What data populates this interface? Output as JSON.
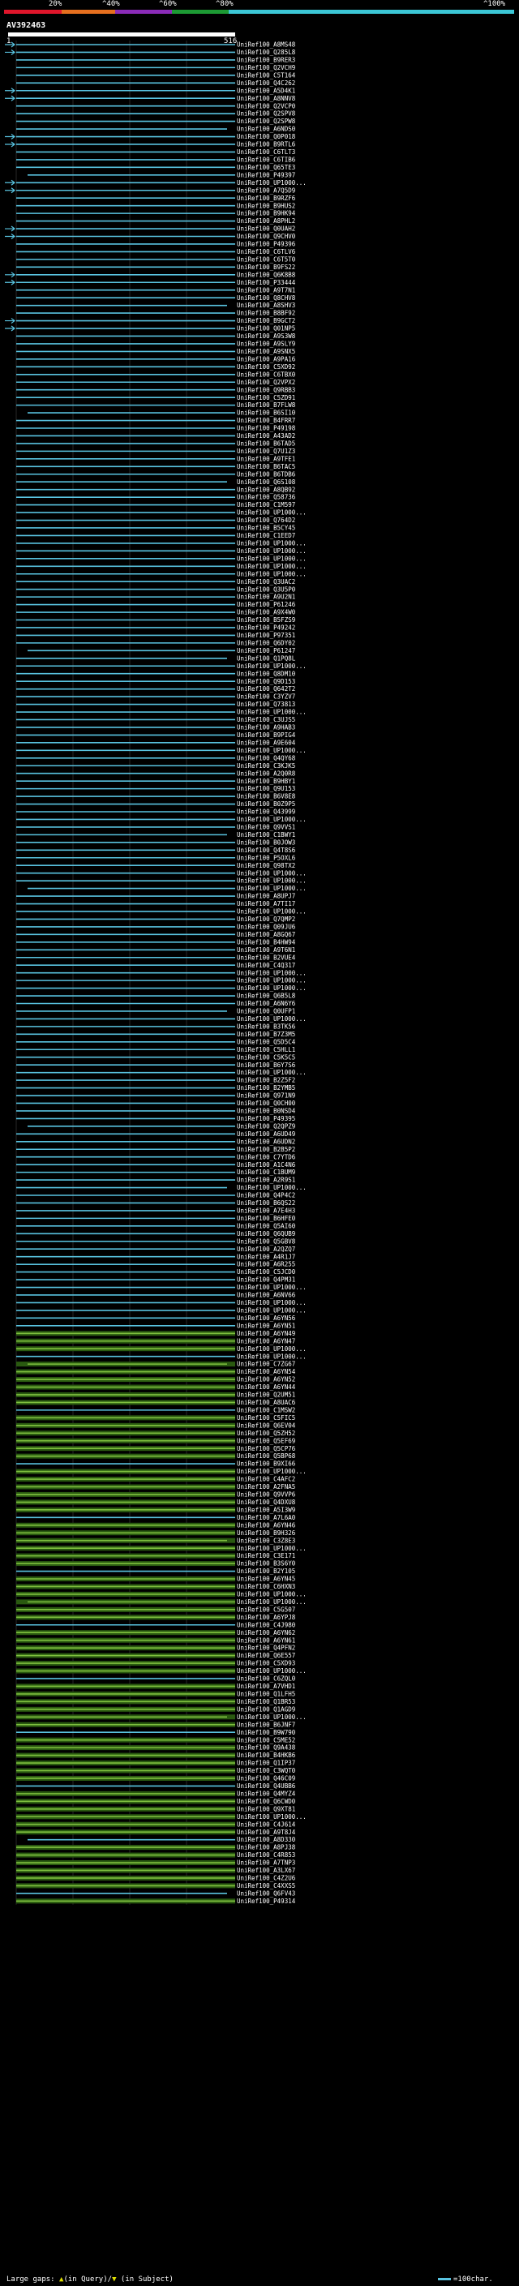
{
  "scale": {
    "ticks": [
      "20%",
      "^40%",
      "^60%",
      "^80%",
      "^100%"
    ],
    "colors": [
      "#e0162b",
      "#e56f1f",
      "#8a2bb8",
      "#1d9a34",
      "#3cc7d6"
    ]
  },
  "query": {
    "id": "AV392463",
    "start": "1",
    "end": "516"
  },
  "colors": {
    "cyan": "#59c3e0",
    "green": "#7fbf3f",
    "dark_green": "#2a5a10",
    "grid": "#444444"
  },
  "hits": [
    "UniRef100_A8MS48",
    "UniRef100_Q285L8",
    "UniRef100_B9RER3",
    "UniRef100_Q2VCH9",
    "UniRef100_C5T164",
    "UniRef100_Q4C262",
    "UniRef100_A5D4K1",
    "UniRef100_A8NNV8",
    "UniRef100_Q2VCP0",
    "UniRef100_Q2SPV8",
    "UniRef100_Q2SPW8",
    "UniRef100_A6NDS0",
    "UniRef100_Q0P018",
    "UniRef100_B9RTL6",
    "UniRef100_C6TLT3",
    "UniRef100_C6TIB6",
    "UniRef100_Q65TE3",
    "UniRef100_P49397",
    "UniRef100_UP1000...",
    "UniRef100_A7Q5D9",
    "UniRef100_B9RZF6",
    "UniRef100_B9HUS2",
    "UniRef100_B9HK94",
    "UniRef100_A8PHL2",
    "UniRef100_Q0UAH2",
    "UniRef100_Q9CHV0",
    "UniRef100_P49396",
    "UniRef100_C6TLV6",
    "UniRef100_C6T5T0",
    "UniRef100_B9FS22",
    "UniRef100_Q6K8B8",
    "UniRef100_P33444",
    "UniRef100_A9T7N1",
    "UniRef100_Q8CHV8",
    "UniRef100_A8SHV3",
    "UniRef100_B8BF92",
    "UniRef100_B9GCT2",
    "UniRef100_Q01NP5",
    "UniRef100_A9S3W8",
    "UniRef100_A9SLY9",
    "UniRef100_A9SNX5",
    "UniRef100_A9PA16",
    "UniRef100_C5XD92",
    "UniRef100_C6TBX0",
    "UniRef100_Q2VPX2",
    "UniRef100_Q9RBB3",
    "UniRef100_C5ZD91",
    "UniRef100_B7FLW8",
    "UniRef100_B6SI10",
    "UniRef100_B4FRR7",
    "UniRef100_P49198",
    "UniRef100_A43AD2",
    "UniRef100_B6TAD5",
    "UniRef100_Q7U1Z3",
    "UniRef100_A9TFE1",
    "UniRef100_B6TAC5",
    "UniRef100_B6TDB6",
    "UniRef100_Q6S108",
    "UniRef100_A8QB92",
    "UniRef100_Q58736",
    "UniRef100_C1M597",
    "UniRef100_UP1000...",
    "UniRef100_Q764D2",
    "UniRef100_B5CY45",
    "UniRef100_C1EED7",
    "UniRef100_UP1000...",
    "UniRef100_UP1000...",
    "UniRef100_UP1000...",
    "UniRef100_UP1000...",
    "UniRef100_UP1000...",
    "UniRef100_Q3UAC2",
    "UniRef100_Q3U5P0",
    "UniRef100_A9U2N1",
    "UniRef100_P61246",
    "UniRef100_A9X4W0",
    "UniRef100_B5FZS9",
    "UniRef100_P49242",
    "UniRef100_P97351",
    "UniRef100_Q6DY02",
    "UniRef100_P61247",
    "UniRef100_Q1PQ8L",
    "UniRef100_UP1000...",
    "UniRef100_Q8DM10",
    "UniRef100_Q9D153",
    "UniRef100_Q642T2",
    "UniRef100_C3YZV7",
    "UniRef100_Q73813",
    "UniRef100_UP1000...",
    "UniRef100_C3UJS5",
    "UniRef100_A9HAB3",
    "UniRef100_B9PIG4",
    "UniRef100_A9E604",
    "UniRef100_UP1000...",
    "UniRef100_Q4QY68",
    "UniRef100_C3KJK5",
    "UniRef100_A2Q0R8",
    "UniRef100_B9HBY1",
    "UniRef100_Q9U153",
    "UniRef100_B6V8E8",
    "UniRef100_B0Z9P5",
    "UniRef100_Q43999",
    "UniRef100_UP1000...",
    "UniRef100_Q9VVS1",
    "UniRef100_C1BWY1",
    "UniRef100_B0JOW3",
    "UniRef100_Q4T8S6",
    "UniRef100_P5OXL6",
    "UniRef100_Q98TX2",
    "UniRef100_UP1000...",
    "UniRef100_UP1000...",
    "UniRef100_UP1000...",
    "UniRef100_A8UPJ7",
    "UniRef100_A7TI17",
    "UniRef100_UP1000...",
    "UniRef100_Q7QMP2",
    "UniRef100_Q09JU6",
    "UniRef100_A8GQ67",
    "UniRef100_B4HW94",
    "UniRef100_A9T6N1",
    "UniRef100_B2VUE4",
    "UniRef100_C4Q317",
    "UniRef100_UP1000...",
    "UniRef100_UP1000...",
    "UniRef100_UP1000...",
    "UniRef100_Q6B5L8",
    "UniRef100_A6N6Y6",
    "UniRef100_Q0UFP1",
    "UniRef100_UP1000...",
    "UniRef100_B3TK56",
    "UniRef100_B7Z3M5",
    "UniRef100_Q5D5C4",
    "UniRef100_C5HLL1",
    "UniRef100_C5K5C5",
    "UniRef100_B6Y7S6",
    "UniRef100_UP1000...",
    "UniRef100_B2Z5F2",
    "UniRef100_B2YMB5",
    "UniRef100_Q971N9",
    "UniRef100_Q0CH00",
    "UniRef100_B0NSD4",
    "UniRef100_P49395",
    "UniRef100_Q2QPZ9",
    "UniRef100_A6UD49",
    "UniRef100_A6UDN2",
    "UniRef100_B2B5P2",
    "UniRef100_C7YTD6",
    "UniRef100_A1C4N6",
    "UniRef100_C1BUM9",
    "UniRef100_A2R9S1",
    "UniRef100_UP1000...",
    "UniRef100_Q4P4C2",
    "UniRef100_B6QS22",
    "UniRef100_A7E4H3",
    "UniRef100_B6HFE0",
    "UniRef100_Q5AI60",
    "UniRef100_Q6QUB9",
    "UniRef100_Q5GBV8",
    "UniRef100_A2QZQ7",
    "UniRef100_A4R1J7",
    "UniRef100_A6R255",
    "UniRef100_C5JCD0",
    "UniRef100_Q4PM31",
    "UniRef100_UP1000...",
    "UniRef100_A6NV66",
    "UniRef100_UP1000...",
    "UniRef100_UP1000...",
    "UniRef100_A6YN56",
    "UniRef100_A6YN51",
    "UniRef100_A6YN49",
    "UniRef100_A6YN47",
    "UniRef100_UP1000...",
    "UniRef100_UP1000...",
    "UniRef100_C7ZG67",
    "UniRef100_A6YN54",
    "UniRef100_A6YN52",
    "UniRef100_A6YN44",
    "UniRef100_Q2UM51",
    "UniRef100_A8UAC6",
    "UniRef100_C1MSW2",
    "UniRef100_C5FIC5",
    "UniRef100_Q6EV04",
    "UniRef100_Q5ZH52",
    "UniRef100_Q5EF69",
    "UniRef100_Q5CP76",
    "UniRef100_Q5BP68",
    "UniRef100_B9XI66",
    "UniRef100_UP1000...",
    "UniRef100_C4AFC2",
    "UniRef100_A2FNA5",
    "UniRef100_Q9VVP6",
    "UniRef100_Q4DXU8",
    "UniRef100_A5I3W9",
    "UniRef100_A7L6A0",
    "UniRef100_A6YN46",
    "UniRef100_B9H326",
    "UniRef100_C3Z8E3",
    "UniRef100_UP1000...",
    "UniRef100_C3E171",
    "UniRef100_B3S6Y0",
    "UniRef100_B2Y105",
    "UniRef100_A6YN45",
    "UniRef100_C6HXN3",
    "UniRef100_UP1000...",
    "UniRef100_UP1000...",
    "UniRef100_C5G507",
    "UniRef100_A6YPJ8",
    "UniRef100_C4J980",
    "UniRef100_A6YN62",
    "UniRef100_A6YN61",
    "UniRef100_Q4PFN2",
    "UniRef100_Q6E557",
    "UniRef100_C5XD93",
    "UniRef100_UP1000...",
    "UniRef100_C6ZQL0",
    "UniRef100_A7VHD1",
    "UniRef100_Q1LFH5",
    "UniRef100_Q1BR53",
    "UniRef100_Q1AGD9",
    "UniRef100_UP1000...",
    "UniRef100_B6JNF7",
    "UniRef100_B9W790",
    "UniRef100_C5ME52",
    "UniRef100_Q9A438",
    "UniRef100_B4HKB6",
    "UniRef100_Q1IP37",
    "UniRef100_C3WQT0",
    "UniRef100_Q46C09",
    "UniRef100_Q4UBB6",
    "UniRef100_Q4MYZ4",
    "UniRef100_Q6CWD0",
    "UniRef100_Q9XT81",
    "UniRef100_UP1000...",
    "UniRef100_C4J614",
    "UniRef100_A9T8J4",
    "UniRef100_A8D330",
    "UniRef100_A8PJ38",
    "UniRef100_C4R853",
    "UniRef100_A7TNP3",
    "UniRef100_A3LX67",
    "UniRef100_C4Z2U6",
    "UniRef100_C4XXS5",
    "UniRef100_Q6FV43",
    "UniRef100_P49314"
  ],
  "legend": {
    "large_gaps": "Large gaps:",
    "in_query": "(in Query)/",
    "in_subject": "(in Subject)",
    "scale_note": "=100char."
  }
}
